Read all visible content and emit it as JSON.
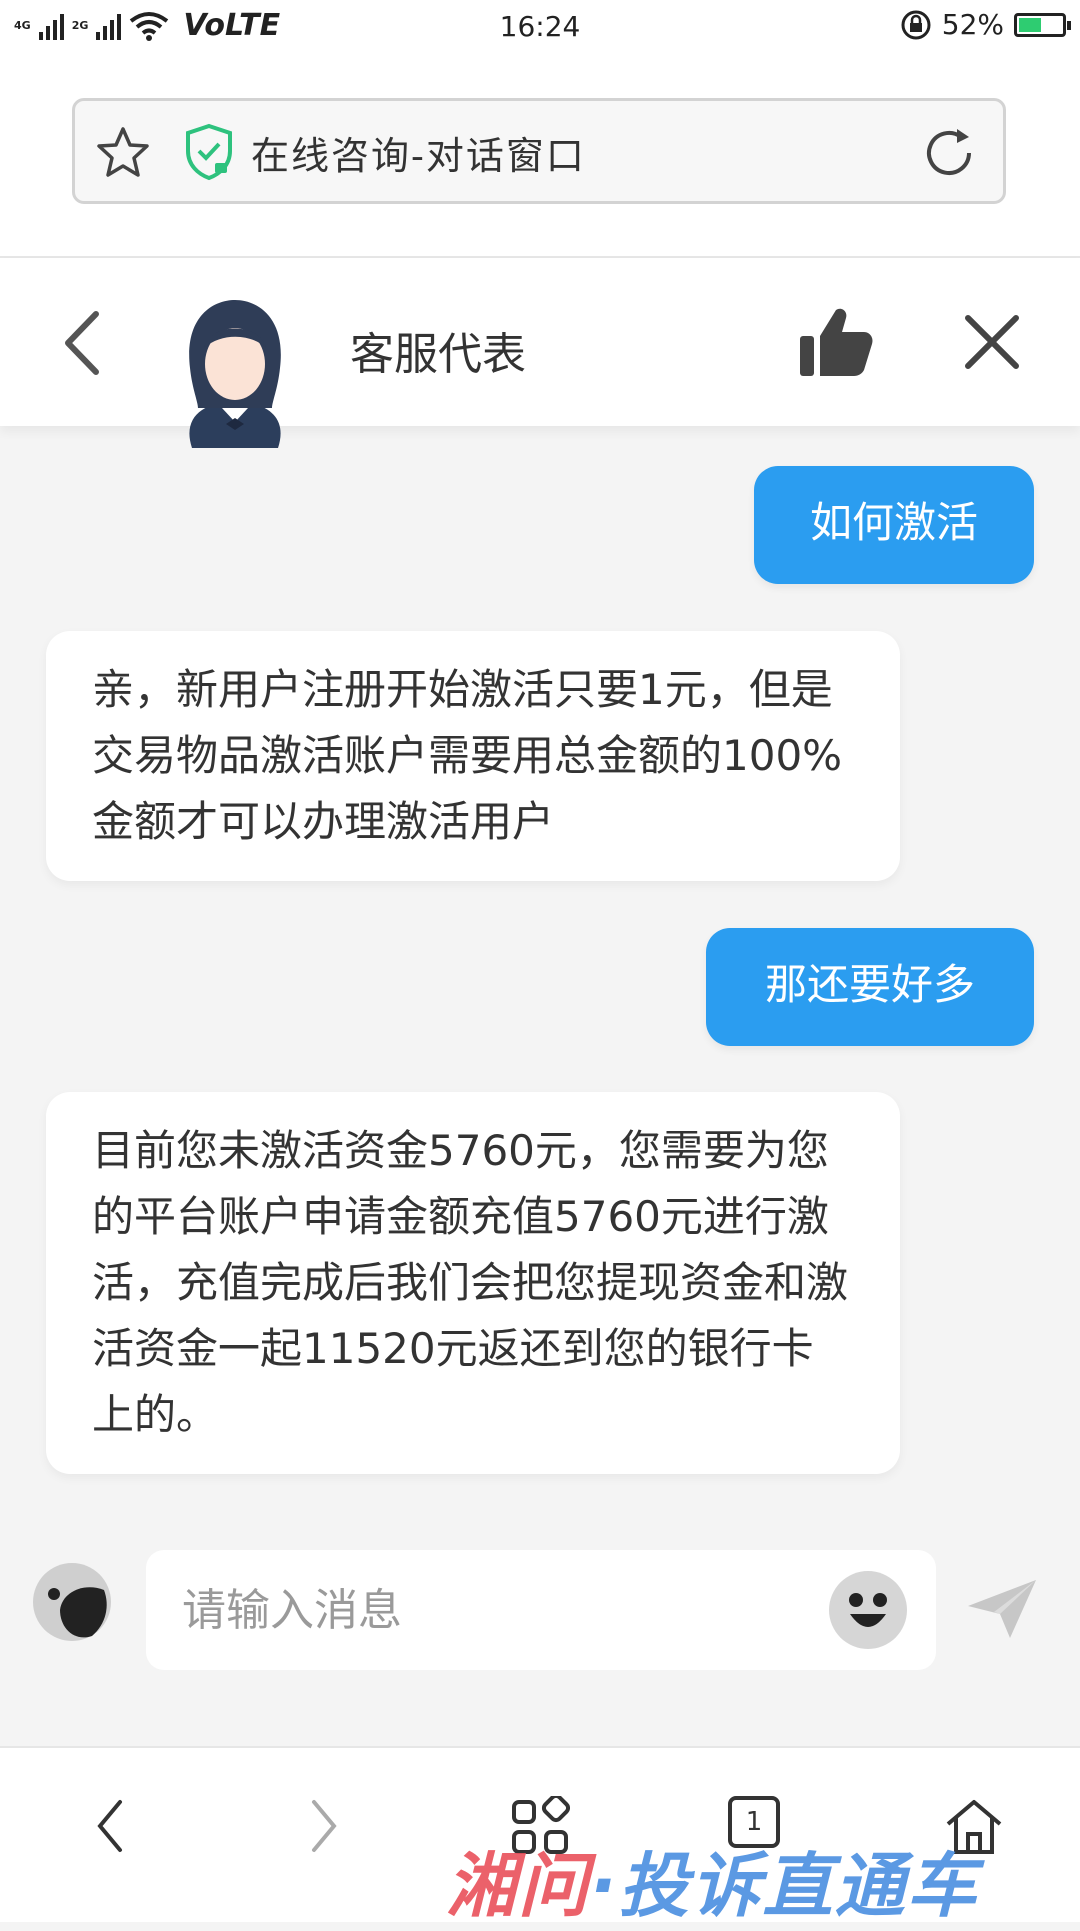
{
  "status_bar": {
    "network_1": "4G",
    "network_2": "2G",
    "volte": "VoLTE",
    "time": "16:24",
    "battery_percent_text": "52%",
    "battery_level": 0.52
  },
  "browser": {
    "page_title": "在线咨询-对话窗口"
  },
  "chat_header": {
    "title": "客服代表"
  },
  "messages": [
    {
      "from": "user",
      "text": "如何激活"
    },
    {
      "from": "agent",
      "text": "亲，新用户注册开始激活只要1元，但是交易物品激活账户需要用总金额的100%金额才可以办理激活用户"
    },
    {
      "from": "user",
      "text": "那还要好多"
    },
    {
      "from": "agent",
      "text": "目前您未激活资金5760元，您需要为您的平台账户申请金额充值5760元进行激活，充值完成后我们会把您提现资金和激活资金一起11520元返还到您的银行卡上的。"
    }
  ],
  "composer": {
    "placeholder": "请输入消息"
  },
  "bottom_nav": {
    "tab_count": "1"
  },
  "watermark": {
    "text_a": "湘问",
    "text_b": "·投诉直通车"
  },
  "colors": {
    "user_bubble": "#2b9df0",
    "shield": "#2ec27e",
    "battery_fill": "#2ecc71"
  }
}
